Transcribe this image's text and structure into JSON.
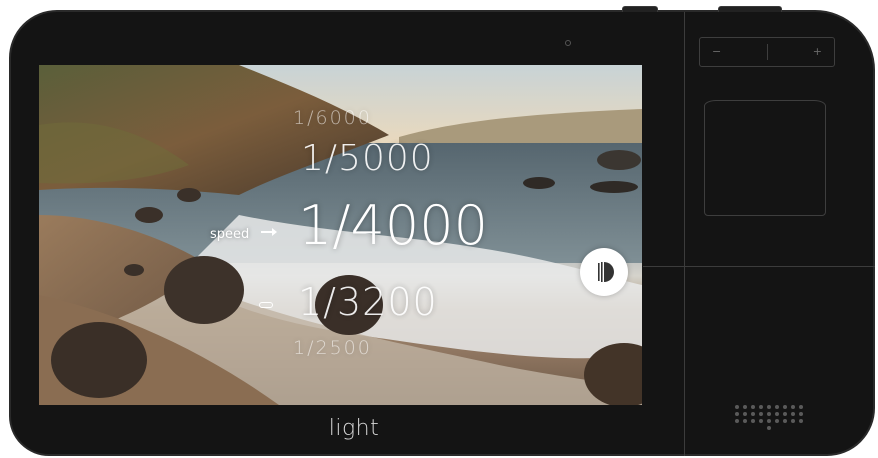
{
  "camera": {
    "brand_logo": "light",
    "zoom": {
      "minus": "−",
      "plus": "+"
    }
  },
  "viewfinder": {
    "setting_label": "speed",
    "shutter_speeds": [
      "1/6000",
      "1/5000",
      "1/4000",
      "1/3200",
      "1/2500"
    ],
    "selected_speed": "1/4000"
  },
  "icons": [
    "arrow-right-icon",
    "pill-icon",
    "shutter-icon",
    "speaker-grille-icon",
    "sensor-icon"
  ]
}
